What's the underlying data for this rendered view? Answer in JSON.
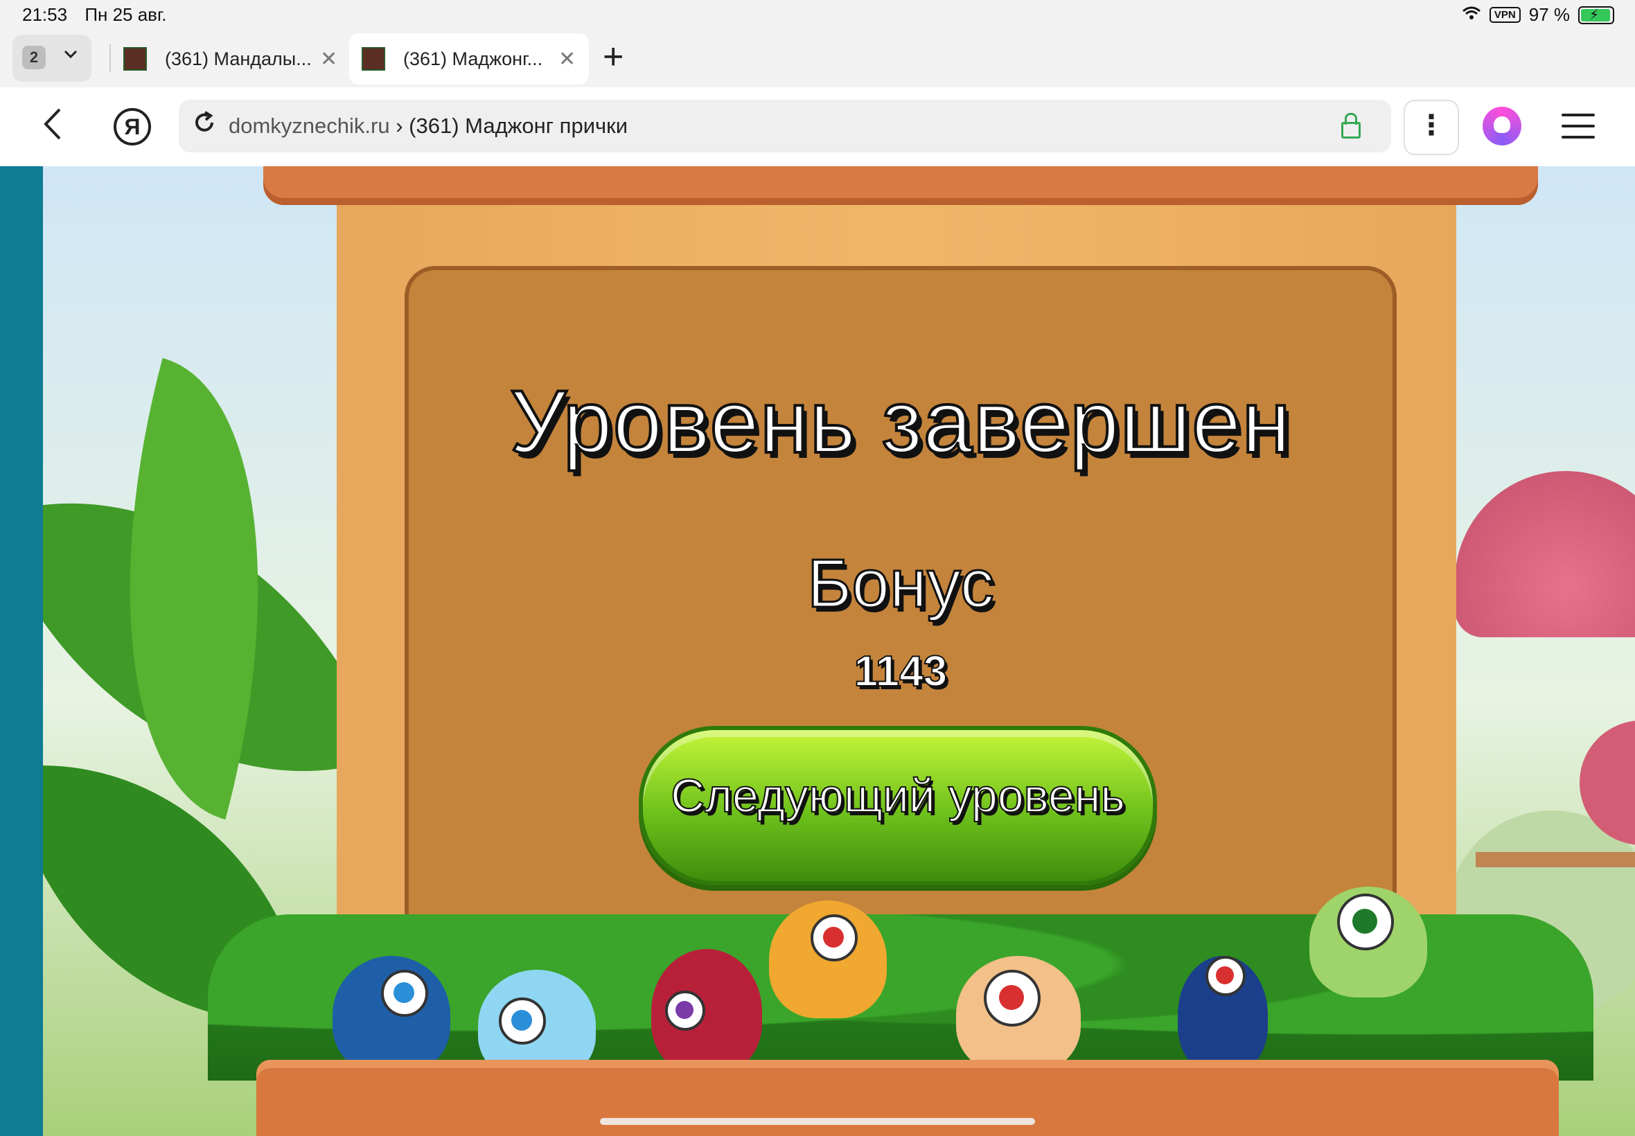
{
  "status_bar": {
    "time": "21:53",
    "date": "Пн 25 авг.",
    "vpn": "VPN",
    "battery": "97 %"
  },
  "tabs": {
    "count": "2",
    "items": [
      {
        "title": "(361) Мандалы...",
        "active": false
      },
      {
        "title": "(361) Маджонг...",
        "active": true
      }
    ]
  },
  "address_bar": {
    "domain": "domkyznechik.ru",
    "separator": "›",
    "page_title": "(361) Маджонг прички"
  },
  "game": {
    "title": "Уровень завершен",
    "bonus_label": "Бонус",
    "bonus_value": "1143",
    "next_button": "Следующий уровень"
  },
  "colors": {
    "board": "#c4843c",
    "pillar": "#f0b76b",
    "button_green": "#6ec11c",
    "left_strip": "#0f7c94"
  },
  "icons": [
    "wifi-icon",
    "vpn-icon",
    "battery-icon",
    "chevron-down-icon",
    "close-icon",
    "plus-icon",
    "back-icon",
    "yandex-icon",
    "reload-icon",
    "lock-icon",
    "more-icon",
    "alice-icon",
    "menu-icon"
  ]
}
